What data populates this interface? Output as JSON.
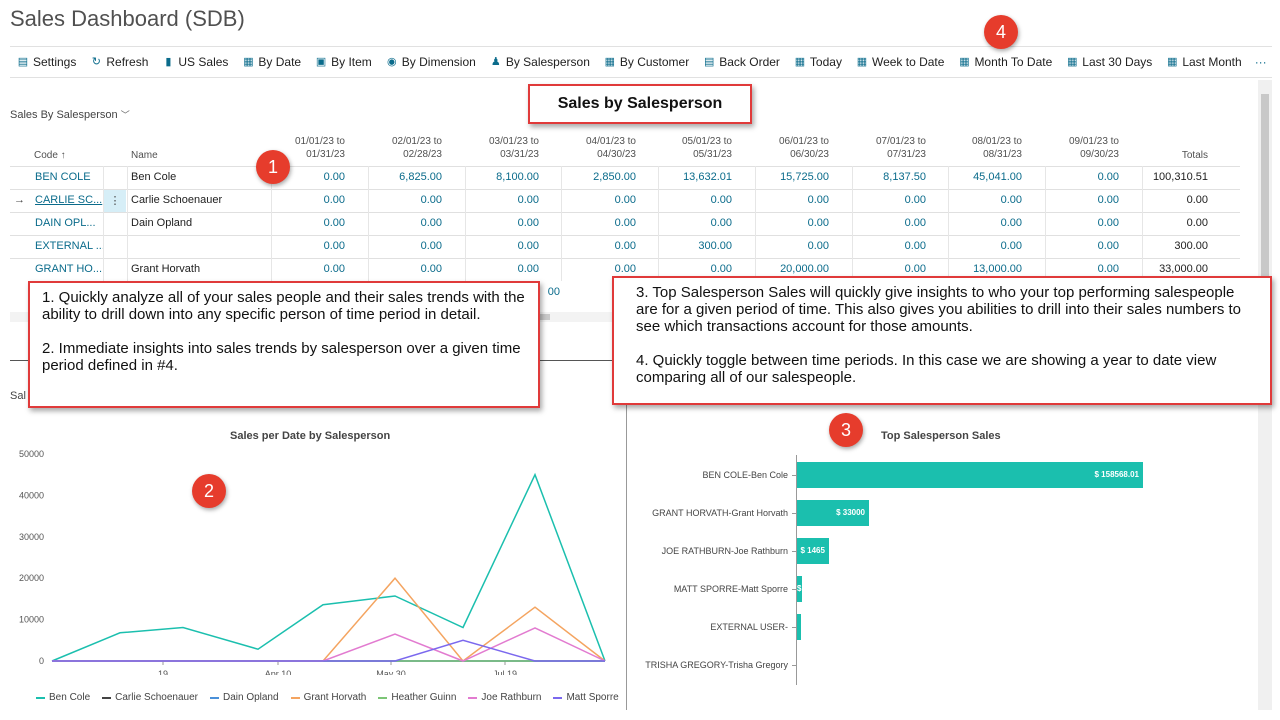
{
  "page_title": "Sales Dashboard (SDB)",
  "toolbar": {
    "items": [
      {
        "label": "Settings",
        "icon": "settings-icon"
      },
      {
        "label": "Refresh",
        "icon": "refresh-icon"
      },
      {
        "label": "US Sales",
        "icon": "chart-icon"
      },
      {
        "label": "By Date",
        "icon": "calendar-icon"
      },
      {
        "label": "By Item",
        "icon": "item-icon"
      },
      {
        "label": "By Dimension",
        "icon": "dimension-icon"
      },
      {
        "label": "By Salesperson",
        "icon": "person-icon"
      },
      {
        "label": "By Customer",
        "icon": "customer-icon"
      },
      {
        "label": "Back Order",
        "icon": "order-icon"
      },
      {
        "label": "Today",
        "icon": "today-icon"
      },
      {
        "label": "Week to Date",
        "icon": "week-icon"
      },
      {
        "label": "Month To Date",
        "icon": "month-icon"
      },
      {
        "label": "Last 30 Days",
        "icon": "days-icon"
      },
      {
        "label": "Last Month",
        "icon": "lastmonth-icon"
      }
    ],
    "more": "···"
  },
  "section_header": "Sales by Salesperson",
  "sub_title": "Sales By Salesperson",
  "sub_title_chevron": "﹀",
  "grid": {
    "col_code": "Code ↑",
    "col_name": "Name",
    "periods": [
      [
        "01/01/23 to",
        "01/31/23"
      ],
      [
        "02/01/23 to",
        "02/28/23"
      ],
      [
        "03/01/23 to",
        "03/31/23"
      ],
      [
        "04/01/23 to",
        "04/30/23"
      ],
      [
        "05/01/23 to",
        "05/31/23"
      ],
      [
        "06/01/23 to",
        "06/30/23"
      ],
      [
        "07/01/23 to",
        "07/31/23"
      ],
      [
        "08/01/23 to",
        "08/31/23"
      ],
      [
        "09/01/23 to",
        "09/30/23"
      ]
    ],
    "col_totals": "Totals",
    "rows": [
      {
        "code": "BEN COLE",
        "name": "Ben Cole",
        "vals": [
          "0.00",
          "6,825.00",
          "8,100.00",
          "2,850.00",
          "13,632.01",
          "15,725.00",
          "8,137.50",
          "45,041.00",
          "0.00"
        ],
        "total": "100,310.51"
      },
      {
        "code": "CARLIE SC...",
        "name": "Carlie Schoenauer",
        "vals": [
          "0.00",
          "0.00",
          "0.00",
          "0.00",
          "0.00",
          "0.00",
          "0.00",
          "0.00",
          "0.00"
        ],
        "total": "0.00"
      },
      {
        "code": "DAIN OPL...",
        "name": "Dain Opland",
        "vals": [
          "0.00",
          "0.00",
          "0.00",
          "0.00",
          "0.00",
          "0.00",
          "0.00",
          "0.00",
          "0.00"
        ],
        "total": "0.00"
      },
      {
        "code": "EXTERNAL ...",
        "name": "",
        "vals": [
          "0.00",
          "0.00",
          "0.00",
          "0.00",
          "300.00",
          "0.00",
          "0.00",
          "0.00",
          "0.00"
        ],
        "total": "300.00"
      },
      {
        "code": "GRANT HO...",
        "name": "Grant Horvath",
        "vals": [
          "0.00",
          "0.00",
          "0.00",
          "0.00",
          "0.00",
          "20,000.00",
          "0.00",
          "13,000.00",
          "0.00"
        ],
        "total": "33,000.00"
      }
    ],
    "partial_value": "00"
  },
  "callouts": {
    "left": "1. Quickly analyze all of your sales people and their sales trends with the ability to drill down into any specific person of time period in detail.\n\n2. Immediate insights into sales trends by salesperson over a given time period defined in #4.",
    "right": "3. Top Salesperson Sales will quickly give insights to who your top performing salespeople are for a given period of time. This also gives you abilities to drill into their sales numbers to see which transactions account for those amounts.\n\n4. Quickly toggle between time periods. In this case we are showing a year to date view comparing all of our salespeople."
  },
  "badges": [
    "1",
    "2",
    "3",
    "4"
  ],
  "left_panel_label": "Sal",
  "chart_data": [
    {
      "type": "line",
      "title": "Sales per Date by Salesperson",
      "y_ticks": [
        "50000",
        "40000",
        "30000",
        "20000",
        "10000",
        "0"
      ],
      "x_ticks": [
        "19",
        "Apr 10",
        "May 30",
        "Jul 19"
      ],
      "ylim": [
        0,
        50000
      ],
      "x_points": 13,
      "series": [
        {
          "name": "Ben Cole",
          "color": "#1bbfae",
          "values": [
            0,
            6800,
            8100,
            2850,
            13600,
            15700,
            8100,
            45000,
            0
          ]
        },
        {
          "name": "Carlie Schoenauer",
          "color": "#444444",
          "values": [
            0,
            0,
            0,
            0,
            0,
            0,
            0,
            0,
            0
          ]
        },
        {
          "name": "Dain Opland",
          "color": "#4a90d9",
          "values": [
            0,
            0,
            0,
            0,
            0,
            0,
            0,
            0,
            0
          ]
        },
        {
          "name": "Grant Horvath",
          "color": "#f4a460",
          "values": [
            0,
            0,
            0,
            0,
            0,
            20000,
            0,
            13000,
            0
          ]
        },
        {
          "name": "Heather Guinn",
          "color": "#7cc576",
          "values": [
            0,
            0,
            0,
            0,
            0,
            0,
            0,
            0,
            0
          ]
        },
        {
          "name": "Joe Rathburn",
          "color": "#e27bd0",
          "values": [
            0,
            0,
            0,
            0,
            0,
            6500,
            0,
            8000,
            0
          ]
        },
        {
          "name": "Matt Sporre",
          "color": "#7b68ee",
          "values": [
            0,
            0,
            0,
            0,
            0,
            0,
            5000,
            0,
            0
          ]
        }
      ]
    },
    {
      "type": "bar",
      "title": "Top Salesperson Sales",
      "categories": [
        "BEN COLE-Ben Cole",
        "GRANT HORVATH-Grant Horvath",
        "JOE RATHBURN-Joe Rathburn",
        "MATT SPORRE-Matt Sporre",
        "EXTERNAL USER-",
        "TRISHA GREGORY-Trisha Gregory"
      ],
      "values": [
        158568.01,
        33000,
        14650,
        2500,
        300,
        0
      ],
      "labels": [
        "$ 158568.01",
        "$ 33000",
        "$ 1465",
        "$",
        "",
        ""
      ],
      "color": "#1bbfae"
    }
  ]
}
